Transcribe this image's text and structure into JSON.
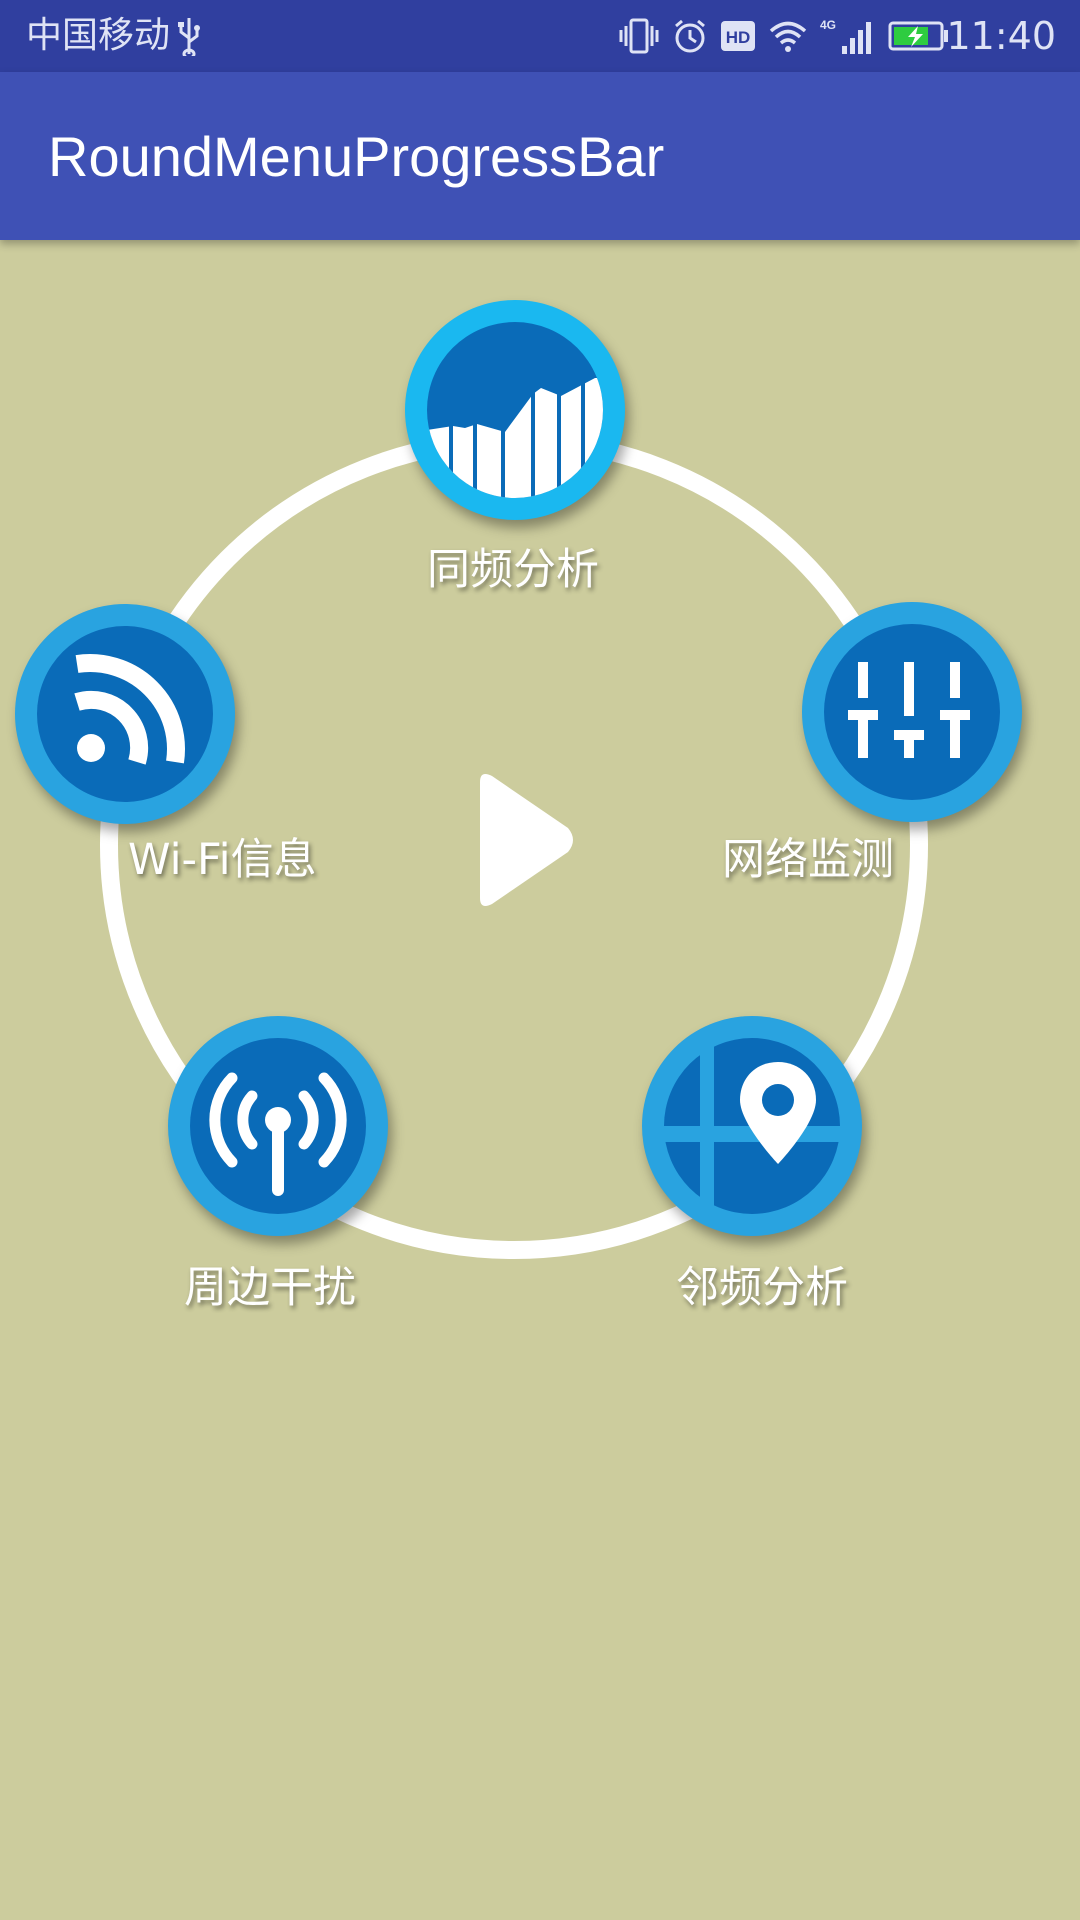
{
  "status_bar": {
    "carrier": "中国移动",
    "network_type": "4G",
    "time": "11:40",
    "icons": [
      "usb-icon",
      "vibrate-icon",
      "alarm-icon",
      "hd-icon",
      "wifi-icon",
      "cell-signal-icon",
      "battery-charging-icon"
    ]
  },
  "app_bar": {
    "title": "RoundMenuProgressBar"
  },
  "menu": {
    "center_icon": "play-icon",
    "items": [
      {
        "label": "同频分析",
        "icon": "bar-chart-icon"
      },
      {
        "label": "网络监测",
        "icon": "equalizer-icon"
      },
      {
        "label": "邻频分析",
        "icon": "map-pin-icon"
      },
      {
        "label": "周边干扰",
        "icon": "antenna-icon"
      },
      {
        "label": "Wi-Fi信息",
        "icon": "rss-icon"
      }
    ]
  },
  "colors": {
    "status_bar": "#303f9f",
    "app_bar": "#3f51b5",
    "background": "#cccc9d",
    "ring": "#ffffff",
    "circle_outer": "#29a3e0",
    "circle_outer_top": "#1ab8f0",
    "circle_inner": "#0a6bb8"
  }
}
